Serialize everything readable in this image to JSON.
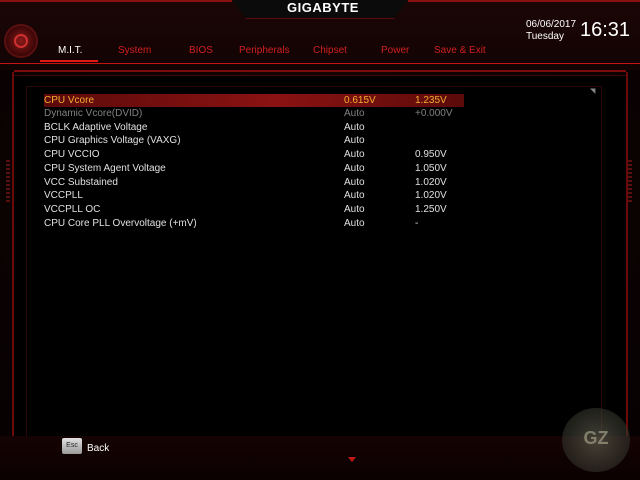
{
  "header": {
    "brand": "GIGABYTE",
    "date": "06/06/2017",
    "weekday": "Tuesday",
    "time": "16:31"
  },
  "tabs": [
    {
      "label": "M.I.T.",
      "active": true
    },
    {
      "label": "System",
      "active": false
    },
    {
      "label": "BIOS",
      "active": false
    },
    {
      "label": "Peripherals",
      "active": false
    },
    {
      "label": "Chipset",
      "active": false
    },
    {
      "label": "Power",
      "active": false
    },
    {
      "label": "Save & Exit",
      "active": false
    }
  ],
  "settings": [
    {
      "name": "CPU Vcore",
      "current": "0.615V",
      "value": "1.235V",
      "state": "selected"
    },
    {
      "name": "Dynamic Vcore(DVID)",
      "current": "Auto",
      "value": "+0.000V",
      "state": "dim"
    },
    {
      "name": "BCLK Adaptive Voltage",
      "current": "Auto",
      "value": "",
      "state": "normal"
    },
    {
      "name": "CPU Graphics Voltage (VAXG)",
      "current": "Auto",
      "value": "",
      "state": "normal"
    },
    {
      "name": "CPU VCCIO",
      "current": "Auto",
      "value": "0.950V",
      "state": "normal"
    },
    {
      "name": "CPU System Agent Voltage",
      "current": "Auto",
      "value": "1.050V",
      "state": "normal"
    },
    {
      "name": "VCC Substained",
      "current": "Auto",
      "value": "1.020V",
      "state": "normal"
    },
    {
      "name": "VCCPLL",
      "current": "Auto",
      "value": "1.020V",
      "state": "normal"
    },
    {
      "name": "VCCPLL OC",
      "current": "Auto",
      "value": "1.250V",
      "state": "normal"
    },
    {
      "name": "CPU Core PLL Overvoltage (+mV)",
      "current": "Auto",
      "value": "-",
      "state": "normal"
    }
  ],
  "footer": {
    "esc_key": "Esc",
    "back_label": "Back"
  },
  "colors": {
    "accent": "#c41414",
    "selected_text": "#f0b030",
    "dim_text": "#808080"
  }
}
